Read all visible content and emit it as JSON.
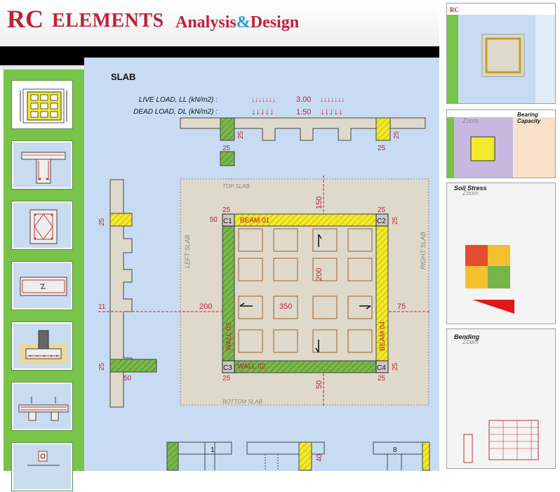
{
  "app": {
    "brand_rc": "RC",
    "brand_elements": "ELEMENTS",
    "brand_analysis": "Analysis",
    "brand_amp": "&",
    "brand_design": "Design"
  },
  "sidebar": {
    "items": [
      {
        "name": "slab",
        "active": true
      },
      {
        "name": "t-beam",
        "active": false
      },
      {
        "name": "column",
        "active": false
      },
      {
        "name": "beam",
        "active": false
      },
      {
        "name": "footing",
        "active": false
      },
      {
        "name": "slab-detail",
        "active": false
      },
      {
        "name": "other",
        "active": false
      }
    ]
  },
  "slab": {
    "title": "SLAB",
    "live_load_label": "LIVE LOAD, LL  (kN/m2) :",
    "live_load_value": "3.00",
    "dead_load_label": "DEAD LOAD, DL  (kN/m2) :",
    "dead_load_value": "1.50",
    "dim_top_beam_left": "25",
    "dim_top_beam_right": "25",
    "dim_top_section_left": "25",
    "dim_top_section_right": "25",
    "dim_left_top": "25",
    "dim_left_mid": "11",
    "dim_left_bottom": "25",
    "dim_left_50": "50",
    "top_slab": "TOP SLAB",
    "bottom_slab": "BOTTOM SLAB",
    "left_slab": "LEFT SLAB",
    "right_slab": "RIGHT SLAB",
    "c1": "C1",
    "c2": "C2",
    "c3": "C3",
    "c4": "C4",
    "beam01": "BEAM 01",
    "wall02": "WALL 02",
    "wall03": "WALL 03",
    "beam04": "BEAM 04",
    "dim_150": "150",
    "dim_200_v": "200",
    "dim_200_h": "200",
    "dim_350": "350",
    "dim_75": "75",
    "dim_50_top": "50",
    "dim_50_bottom": "50",
    "dim_25_c1": "25",
    "dim_25_c2": "25",
    "dim_25_c3": "25",
    "dim_25_c4": "25",
    "bottom_num_1": "1",
    "bottom_num_8": "8",
    "bottom_dim_40": "40",
    "dim_25_c2r": "25",
    "dim_25_c4r": "25"
  },
  "thumbnails": {
    "bearing": "Bearing Capacity",
    "soil_stress": "Soil Stress",
    "bending": "Bending",
    "zoom": "Zoom"
  },
  "colors": {
    "main_bg": "#c7dcf3",
    "sidebar": "#78c44a",
    "accent_red": "#c0203a",
    "beam_yellow": "#f2ea2a",
    "wall_green": "#7ab84a",
    "slab_fill": "#ded9cb"
  }
}
